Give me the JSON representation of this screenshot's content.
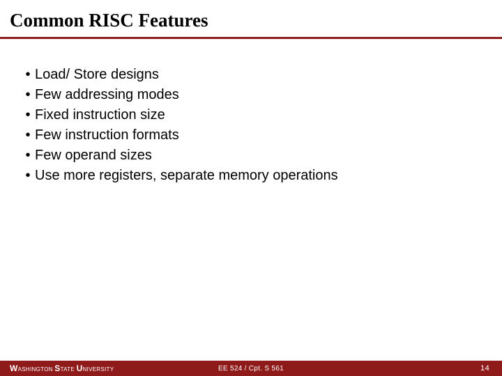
{
  "title": "Common RISC Features",
  "bullets": [
    "Load/ Store designs",
    "Few addressing modes",
    "Fixed instruction size",
    "Few instruction formats",
    "Few operand sizes",
    "Use more registers, separate memory operations"
  ],
  "footer": {
    "uni_w": "W",
    "uni_ash": "ASHINGTON ",
    "uni_s": "S",
    "uni_tate": "TATE ",
    "uni_u": "U",
    "uni_niv": "NIVERSITY",
    "course": "EE 524 / Cpt. S 561",
    "page": "14"
  },
  "bullet_char": "•"
}
